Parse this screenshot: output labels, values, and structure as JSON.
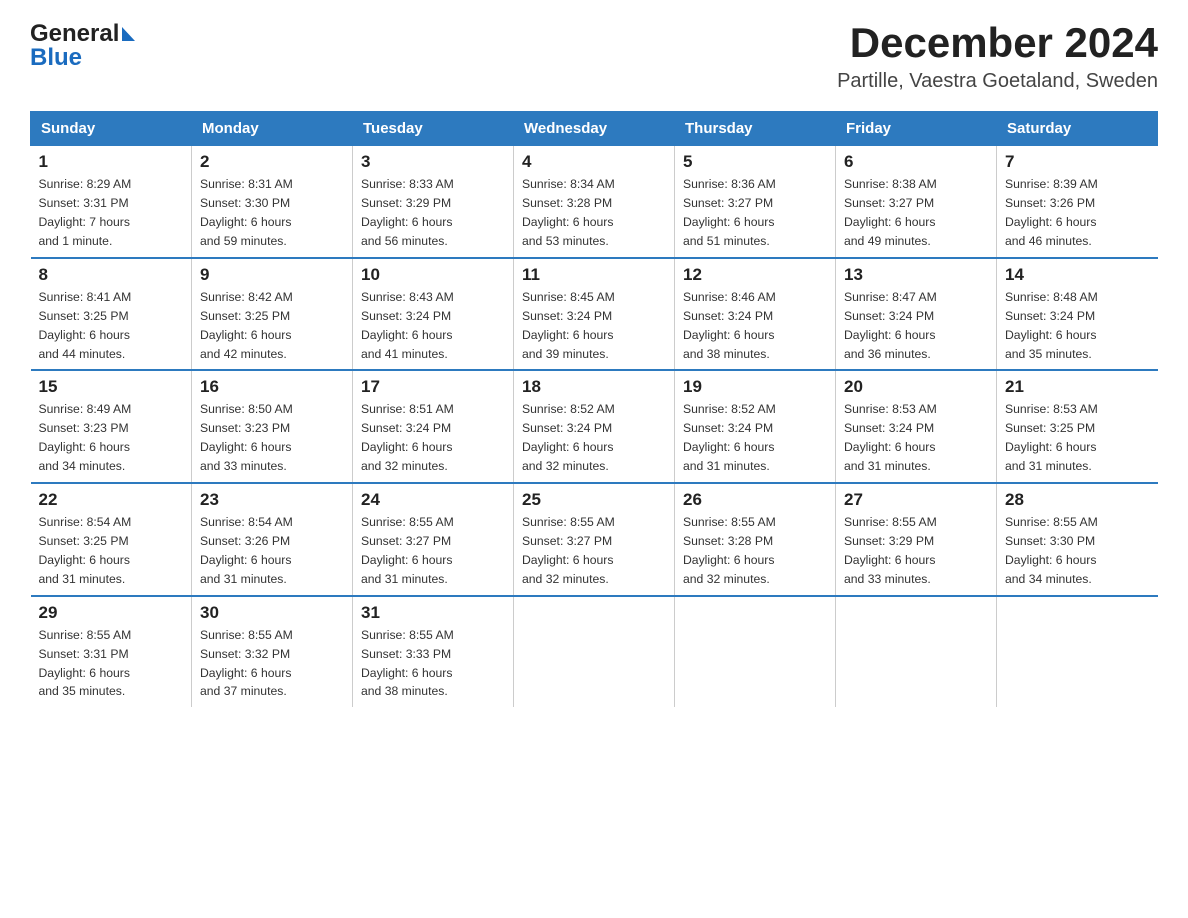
{
  "header": {
    "logo_general": "General",
    "logo_blue": "Blue",
    "title": "December 2024",
    "subtitle": "Partille, Vaestra Goetaland, Sweden"
  },
  "days_of_week": [
    "Sunday",
    "Monday",
    "Tuesday",
    "Wednesday",
    "Thursday",
    "Friday",
    "Saturday"
  ],
  "weeks": [
    [
      {
        "day": "1",
        "sunrise": "8:29 AM",
        "sunset": "3:31 PM",
        "daylight": "7 hours and 1 minute."
      },
      {
        "day": "2",
        "sunrise": "8:31 AM",
        "sunset": "3:30 PM",
        "daylight": "6 hours and 59 minutes."
      },
      {
        "day": "3",
        "sunrise": "8:33 AM",
        "sunset": "3:29 PM",
        "daylight": "6 hours and 56 minutes."
      },
      {
        "day": "4",
        "sunrise": "8:34 AM",
        "sunset": "3:28 PM",
        "daylight": "6 hours and 53 minutes."
      },
      {
        "day": "5",
        "sunrise": "8:36 AM",
        "sunset": "3:27 PM",
        "daylight": "6 hours and 51 minutes."
      },
      {
        "day": "6",
        "sunrise": "8:38 AM",
        "sunset": "3:27 PM",
        "daylight": "6 hours and 49 minutes."
      },
      {
        "day": "7",
        "sunrise": "8:39 AM",
        "sunset": "3:26 PM",
        "daylight": "6 hours and 46 minutes."
      }
    ],
    [
      {
        "day": "8",
        "sunrise": "8:41 AM",
        "sunset": "3:25 PM",
        "daylight": "6 hours and 44 minutes."
      },
      {
        "day": "9",
        "sunrise": "8:42 AM",
        "sunset": "3:25 PM",
        "daylight": "6 hours and 42 minutes."
      },
      {
        "day": "10",
        "sunrise": "8:43 AM",
        "sunset": "3:24 PM",
        "daylight": "6 hours and 41 minutes."
      },
      {
        "day": "11",
        "sunrise": "8:45 AM",
        "sunset": "3:24 PM",
        "daylight": "6 hours and 39 minutes."
      },
      {
        "day": "12",
        "sunrise": "8:46 AM",
        "sunset": "3:24 PM",
        "daylight": "6 hours and 38 minutes."
      },
      {
        "day": "13",
        "sunrise": "8:47 AM",
        "sunset": "3:24 PM",
        "daylight": "6 hours and 36 minutes."
      },
      {
        "day": "14",
        "sunrise": "8:48 AM",
        "sunset": "3:24 PM",
        "daylight": "6 hours and 35 minutes."
      }
    ],
    [
      {
        "day": "15",
        "sunrise": "8:49 AM",
        "sunset": "3:23 PM",
        "daylight": "6 hours and 34 minutes."
      },
      {
        "day": "16",
        "sunrise": "8:50 AM",
        "sunset": "3:23 PM",
        "daylight": "6 hours and 33 minutes."
      },
      {
        "day": "17",
        "sunrise": "8:51 AM",
        "sunset": "3:24 PM",
        "daylight": "6 hours and 32 minutes."
      },
      {
        "day": "18",
        "sunrise": "8:52 AM",
        "sunset": "3:24 PM",
        "daylight": "6 hours and 32 minutes."
      },
      {
        "day": "19",
        "sunrise": "8:52 AM",
        "sunset": "3:24 PM",
        "daylight": "6 hours and 31 minutes."
      },
      {
        "day": "20",
        "sunrise": "8:53 AM",
        "sunset": "3:24 PM",
        "daylight": "6 hours and 31 minutes."
      },
      {
        "day": "21",
        "sunrise": "8:53 AM",
        "sunset": "3:25 PM",
        "daylight": "6 hours and 31 minutes."
      }
    ],
    [
      {
        "day": "22",
        "sunrise": "8:54 AM",
        "sunset": "3:25 PM",
        "daylight": "6 hours and 31 minutes."
      },
      {
        "day": "23",
        "sunrise": "8:54 AM",
        "sunset": "3:26 PM",
        "daylight": "6 hours and 31 minutes."
      },
      {
        "day": "24",
        "sunrise": "8:55 AM",
        "sunset": "3:27 PM",
        "daylight": "6 hours and 31 minutes."
      },
      {
        "day": "25",
        "sunrise": "8:55 AM",
        "sunset": "3:27 PM",
        "daylight": "6 hours and 32 minutes."
      },
      {
        "day": "26",
        "sunrise": "8:55 AM",
        "sunset": "3:28 PM",
        "daylight": "6 hours and 32 minutes."
      },
      {
        "day": "27",
        "sunrise": "8:55 AM",
        "sunset": "3:29 PM",
        "daylight": "6 hours and 33 minutes."
      },
      {
        "day": "28",
        "sunrise": "8:55 AM",
        "sunset": "3:30 PM",
        "daylight": "6 hours and 34 minutes."
      }
    ],
    [
      {
        "day": "29",
        "sunrise": "8:55 AM",
        "sunset": "3:31 PM",
        "daylight": "6 hours and 35 minutes."
      },
      {
        "day": "30",
        "sunrise": "8:55 AM",
        "sunset": "3:32 PM",
        "daylight": "6 hours and 37 minutes."
      },
      {
        "day": "31",
        "sunrise": "8:55 AM",
        "sunset": "3:33 PM",
        "daylight": "6 hours and 38 minutes."
      },
      null,
      null,
      null,
      null
    ]
  ],
  "labels": {
    "sunrise": "Sunrise:",
    "sunset": "Sunset:",
    "daylight": "Daylight:"
  }
}
